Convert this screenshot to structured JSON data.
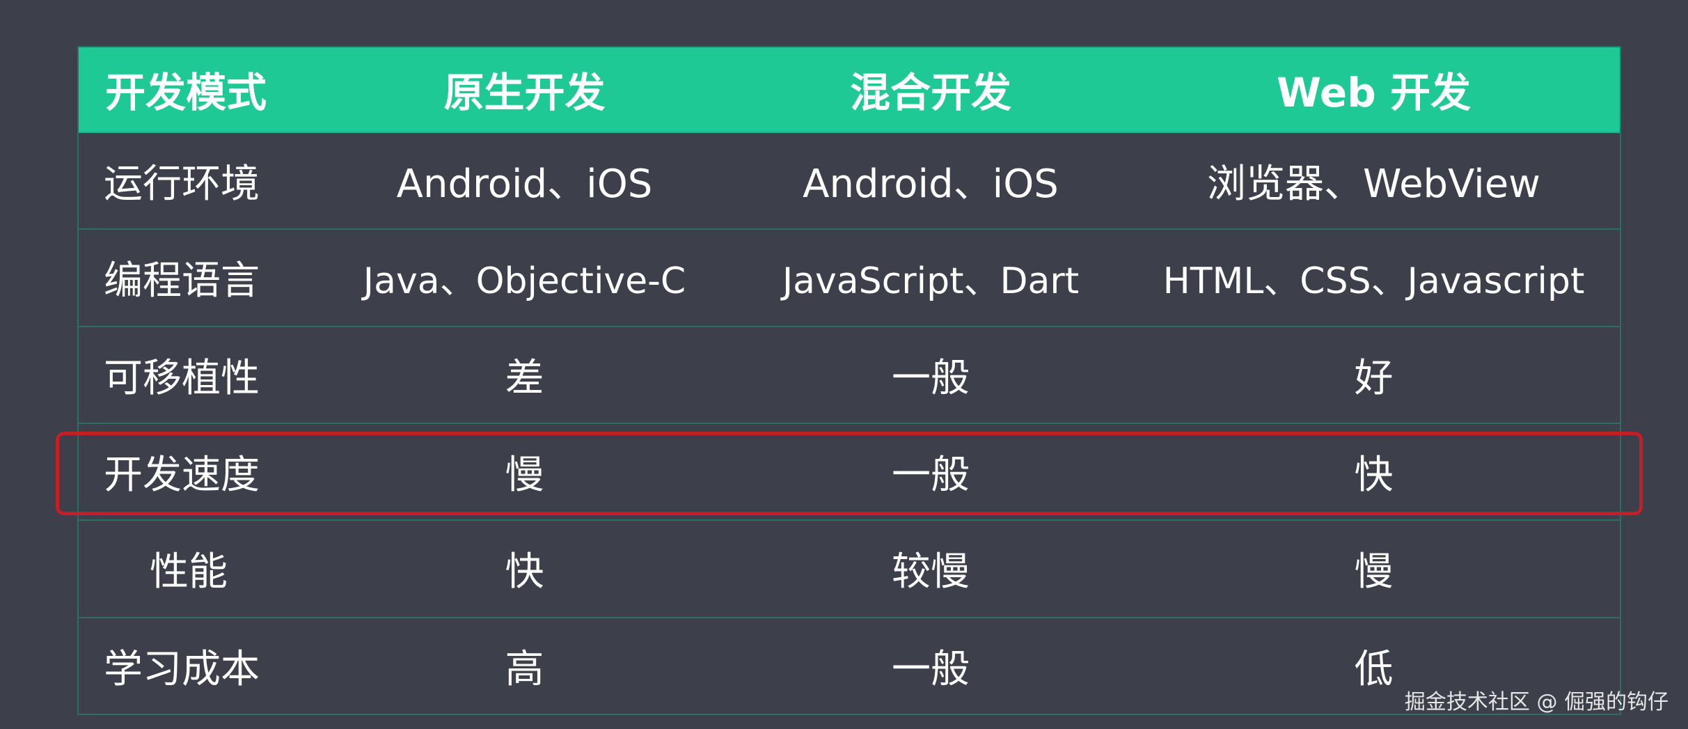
{
  "table": {
    "header": [
      "开发模式",
      "原生开发",
      "混合开发",
      "Web 开发"
    ],
    "rows": [
      {
        "label": "运行环境",
        "native": "Android、iOS",
        "hybrid": "Android、iOS",
        "web": "浏览器、WebView"
      },
      {
        "label": "编程语言",
        "native": "Java、Objective-C",
        "hybrid": "JavaScript、Dart",
        "web": "HTML、CSS、Javascript"
      },
      {
        "label": "可移植性",
        "native": "差",
        "hybrid": "一般",
        "web": "好"
      },
      {
        "label": "开发速度",
        "native": "慢",
        "hybrid": "一般",
        "web": "快"
      },
      {
        "label": "性能",
        "native": "快",
        "hybrid": "较慢",
        "web": "慢"
      },
      {
        "label": "学习成本",
        "native": "高",
        "hybrid": "一般",
        "web": "低"
      }
    ],
    "highlighted_row": "开发速度"
  },
  "watermark": "掘金技术社区 @ 倔强的钩仔",
  "colors": {
    "background": "#3d3f4a",
    "header_background": "#1fc995",
    "grid_line": "#2c6e65",
    "highlight_border": "#c41e26",
    "text": "#ffffff"
  }
}
